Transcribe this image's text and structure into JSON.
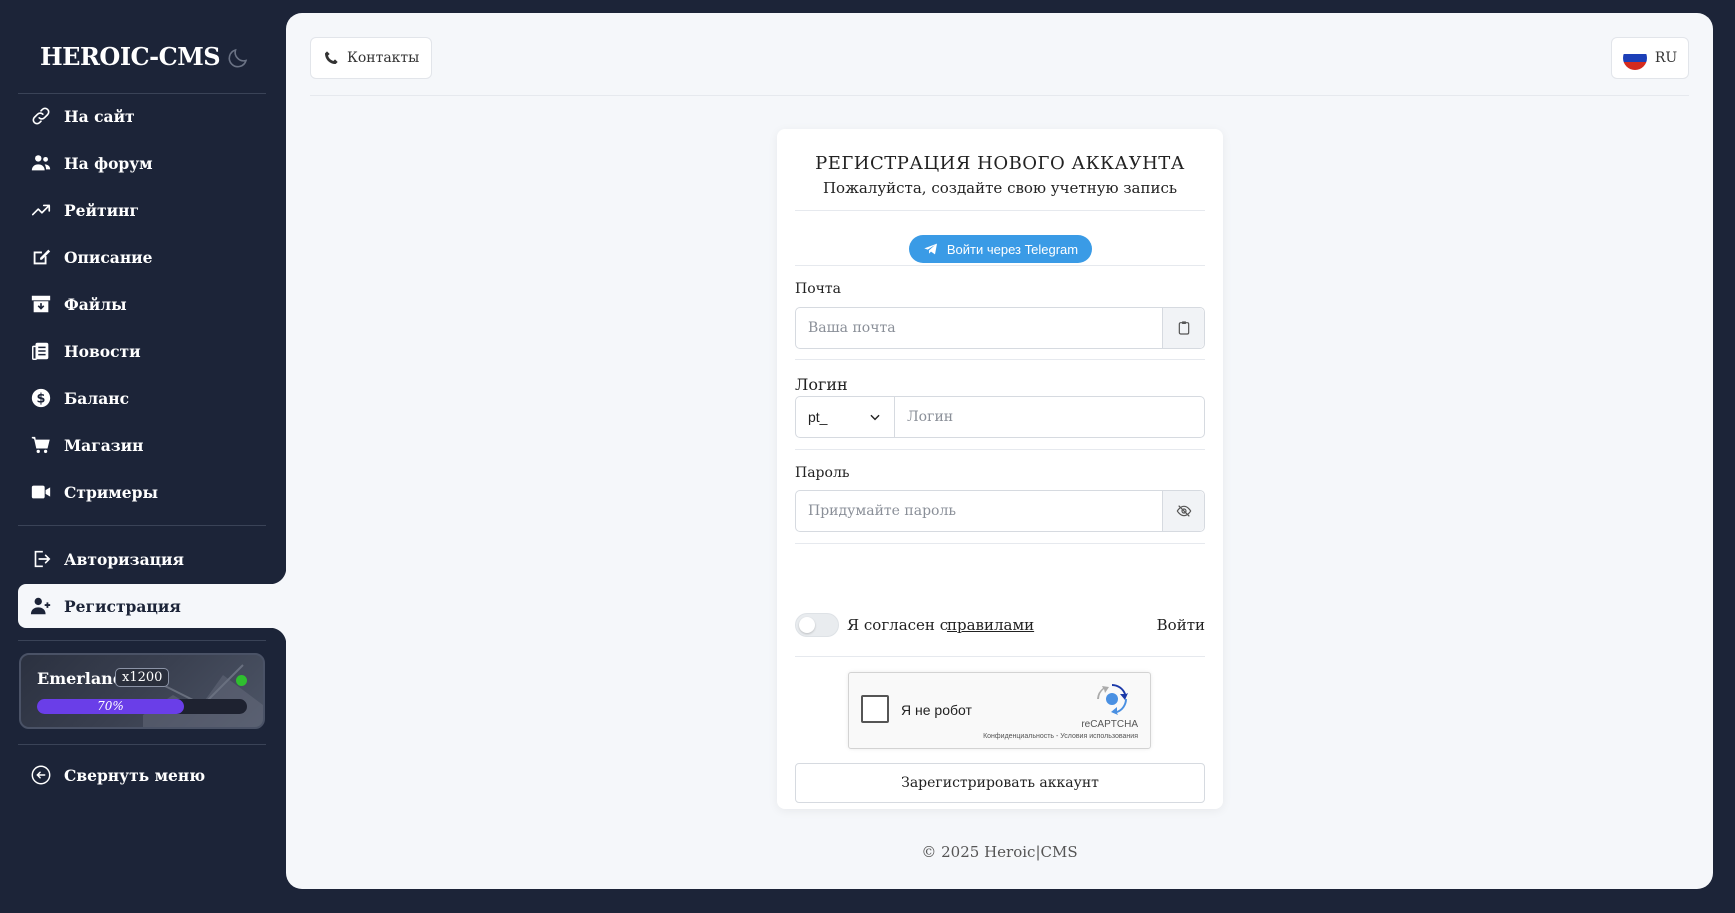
{
  "sidebar": {
    "brand": "HEROIC-CMS",
    "theme_icon": "moon-icon",
    "items": [
      {
        "label": "На сайт",
        "icon": "link-icon"
      },
      {
        "label": "На форум",
        "icon": "users-icon"
      },
      {
        "label": "Рейтинг",
        "icon": "trend-up-icon"
      },
      {
        "label": "Описание",
        "icon": "edit-icon"
      },
      {
        "label": "Файлы",
        "icon": "archive-icon"
      },
      {
        "label": "Новости",
        "icon": "newspaper-icon"
      },
      {
        "label": "Баланс",
        "icon": "dollar-icon"
      },
      {
        "label": "Магазин",
        "icon": "cart-icon"
      },
      {
        "label": "Стримеры",
        "icon": "video-icon"
      }
    ],
    "auth_items": [
      {
        "label": "Авторизация",
        "icon": "sign-in-icon"
      },
      {
        "label": "Регистрация",
        "icon": "user-plus-icon",
        "active": true
      }
    ],
    "server": {
      "name": "Emerland",
      "rate": "x1200",
      "online": true,
      "load_percent": 70,
      "load_label": "70%"
    },
    "collapse_label": "Свернуть меню"
  },
  "header": {
    "contacts_label": "Контакты",
    "language": "RU"
  },
  "form": {
    "title": "РЕГИСТРАЦИЯ НОВОГО АККАУНТА",
    "subtitle": "Пожалуйста, создайте свою учетную запись",
    "telegram_label": "Войти через Telegram",
    "email_label": "Почта",
    "email_placeholder": "Ваша почта",
    "login_label": "Логин",
    "login_prefix": "pt_",
    "login_placeholder": "Логин",
    "password_label": "Пароль",
    "password_placeholder": "Придумайте пароль",
    "agree_text": "Я согласен с",
    "rules_link": "правилами",
    "login_link": "Войти",
    "captcha_label": "Я не робот",
    "captcha_brand": "reCAPTCHA",
    "captcha_terms": "Конфиденциальность - Условия использования",
    "submit_label": "Зарегистрировать аккаунт"
  },
  "footer": {
    "copyright": "© 2025 Heroic|CMS"
  },
  "colors": {
    "sidebar_bg": "#1c2438",
    "main_bg": "#f5f7fa",
    "telegram": "#3a9be6",
    "progress": "#6a3ee8",
    "online": "#2fbf2f"
  }
}
